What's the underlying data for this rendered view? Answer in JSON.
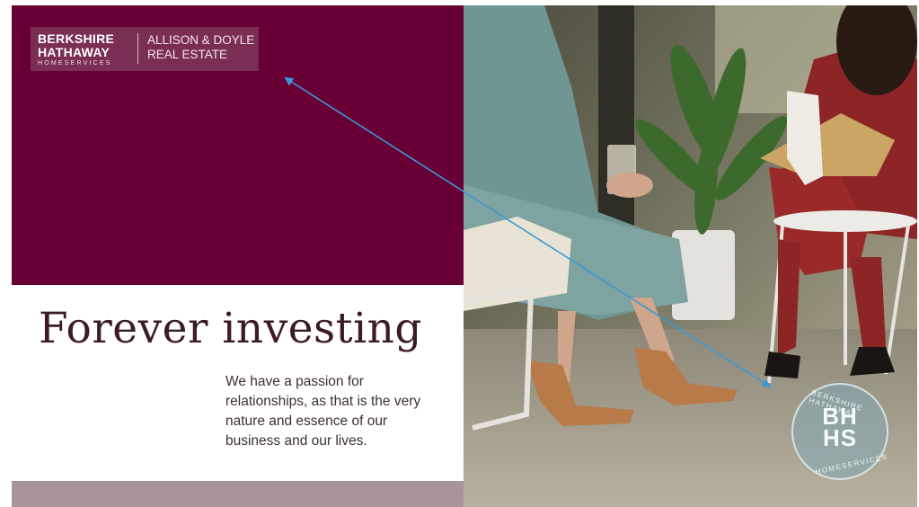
{
  "logo": {
    "brand_line1": "BERKSHIRE",
    "brand_line2": "HATHAWAY",
    "brand_line3": "HOMESERVICES",
    "office_line1": "ALLISON & DOYLE",
    "office_line2": "REAL ESTATE"
  },
  "headline": "Forever investing",
  "tagline": "We have a passion for relationships, as that is the very nature and essence of our business and our lives.",
  "seal": {
    "monogram_line1": "BH",
    "monogram_line2": "HS",
    "ring_top": "BERKSHIRE HATHAWAY",
    "ring_bottom": "HOMESERVICES"
  },
  "photo": {
    "description_icon": "two-women-seated-photo-icon"
  },
  "annotation": {
    "type": "double-headed-arrow",
    "color": "#3a9ad9"
  },
  "colors": {
    "brand_cabernet": "#690035",
    "band_mauve": "#a7949c",
    "headline_text": "#3b1a2a"
  }
}
